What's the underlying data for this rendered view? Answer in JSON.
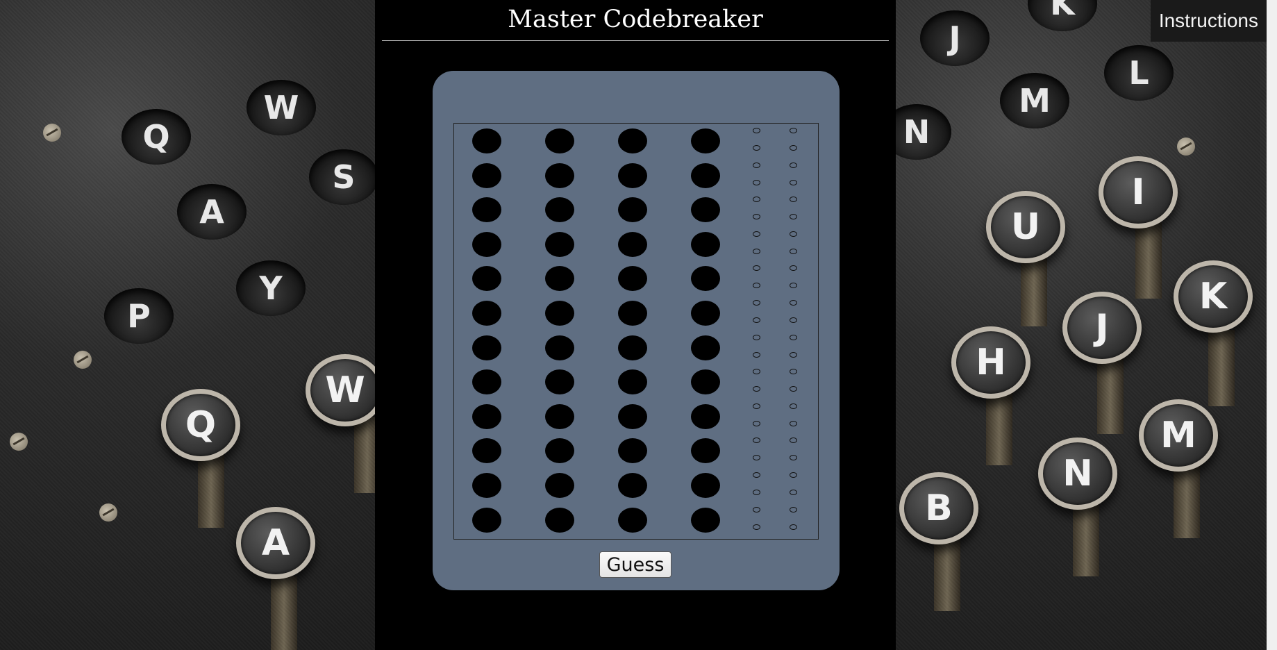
{
  "title": "Master Codebreaker",
  "header": {
    "instructions_label": "Instructions"
  },
  "board": {
    "rows": 12,
    "pegs_per_row": 4,
    "feedback_per_row": 4,
    "peg_color": "#000000",
    "board_color": "#5f6e82"
  },
  "actions": {
    "guess_label": "Guess"
  },
  "background": {
    "left_keys": [
      "Q",
      "W",
      "S",
      "A",
      "P",
      "Y",
      "Q",
      "W",
      "A"
    ],
    "right_keys": [
      "J",
      "K",
      "L",
      "M",
      "N",
      "U",
      "I",
      "J",
      "K",
      "H",
      "N",
      "M",
      "B"
    ]
  }
}
